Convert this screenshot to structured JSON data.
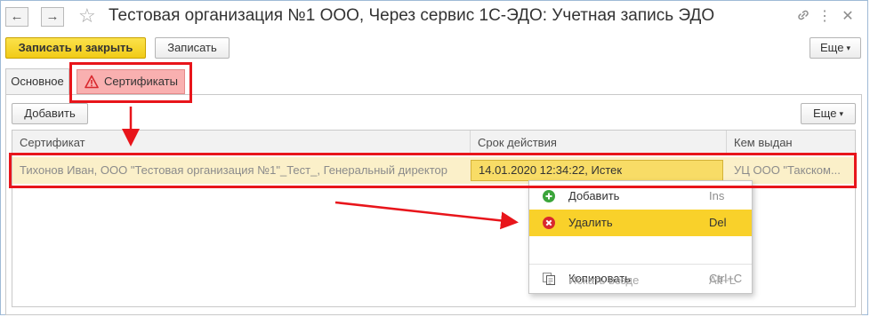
{
  "window": {
    "title": "Тестовая организация №1 ООО, Через сервис 1С-ЭДО: Учетная запись ЭДО",
    "back_icon": "←",
    "forward_icon": "→",
    "star_icon": "☆",
    "link_icon": "🔗",
    "more_icon": "⋮",
    "close_icon": "✕"
  },
  "toolbar": {
    "save_close_label": "Записать и закрыть",
    "save_label": "Записать",
    "more_label": "Еще"
  },
  "tabs": [
    {
      "label": "Основное"
    },
    {
      "label": "Сертификаты"
    }
  ],
  "certificates": {
    "add_label": "Добавить",
    "more_label": "Еще",
    "columns": [
      "Сертификат",
      "Срок действия",
      "Кем выдан"
    ],
    "rows": [
      {
        "certificate": "Тихонов Иван, ООО \"Тестовая организация №1\"_Тест_, Генеральный директор",
        "validity": "14.01.2020 12:34:22, Истек",
        "issuer": "УЦ ООО \"Такском..."
      }
    ]
  },
  "context_menu": {
    "items": [
      {
        "label": "Добавить",
        "shortcut": "Ins",
        "icon": "add-icon"
      },
      {
        "label": "Удалить",
        "shortcut": "Del",
        "icon": "delete-icon"
      },
      {
        "label": "Копировать",
        "shortcut": "Ctrl+C",
        "icon": "copy-icon"
      },
      {
        "label": "Искать везде",
        "shortcut": "Alt+L"
      }
    ]
  },
  "colors": {
    "annotation_red": "#e8151b",
    "primary_yellow": "#f1cb17",
    "tab_error_pink": "#f9b0b0",
    "row_highlight": "#fbf0c9",
    "menu_highlight": "#f9d12a",
    "add_green": "#3ba53b",
    "delete_red": "#d9282e"
  }
}
